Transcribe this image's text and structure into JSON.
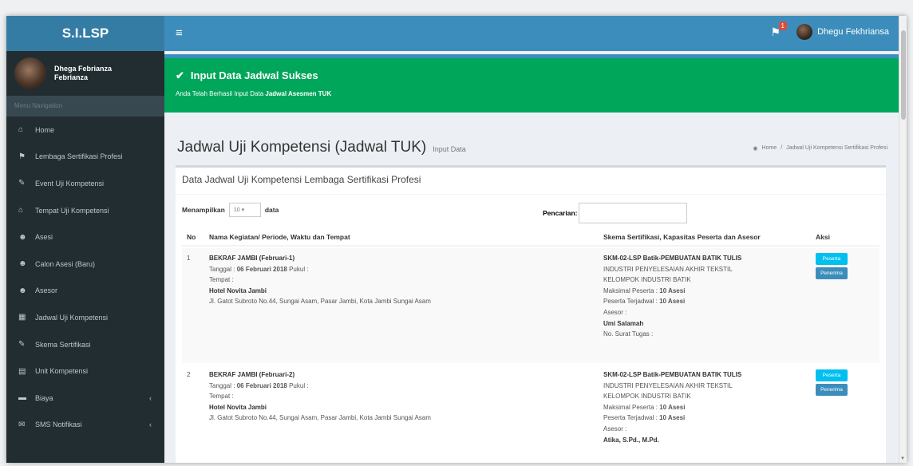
{
  "header": {
    "logo": "S.I.LSP",
    "menu_icon": "bars-icon",
    "notification_icon": "flag-icon",
    "notification_count": "1",
    "user_name": "Dhegu Fekhriansa"
  },
  "sidebar": {
    "user_name": "Dhega Febrianza Febrianza",
    "search_placeholder": "Menu Navigation",
    "items": [
      {
        "label": "Home",
        "icon": "home-icon",
        "has_caret": false
      },
      {
        "label": "Lembaga Sertifikasi Profesi",
        "icon": "flag-icon",
        "has_caret": false
      },
      {
        "label": "Event Uji Kompetensi",
        "icon": "edit-icon",
        "has_caret": false
      },
      {
        "label": "Tempat Uji Kompetensi",
        "icon": "institution-icon",
        "has_caret": false
      },
      {
        "label": "Asesi",
        "icon": "users-icon",
        "has_caret": false
      },
      {
        "label": "Calon Asesi (Baru)",
        "icon": "users-icon",
        "has_caret": false
      },
      {
        "label": "Asesor",
        "icon": "users-icon",
        "has_caret": false
      },
      {
        "label": "Jadwal Uji Kompetensi",
        "icon": "calendar-icon",
        "has_caret": false
      },
      {
        "label": "Skema Sertifikasi",
        "icon": "edit-icon",
        "has_caret": false
      },
      {
        "label": "Unit Kompetensi",
        "icon": "file-icon",
        "has_caret": false
      },
      {
        "label": "Biaya",
        "icon": "folder-icon",
        "has_caret": true
      },
      {
        "label": "SMS Notifikasi",
        "icon": "envelope-icon",
        "has_caret": true
      }
    ]
  },
  "alert": {
    "title": "Input Data Jadwal Sukses",
    "message_prefix": "Anda Telah Berhasil Input Data ",
    "message_bold": "Jadwal Asesmen TUK"
  },
  "page": {
    "title": "Jadwal Uji Kompetensi (Jadwal TUK)",
    "subtitle": "Input Data",
    "breadcrumb_home": "Home",
    "breadcrumb_current": "Jadwal Uji Kompetensi Sertifikasi Profesi"
  },
  "box": {
    "title": "Data Jadwal Uji Kompetensi Lembaga Sertifikasi Profesi",
    "show_label": "Menampilkan",
    "show_value": "10",
    "show_suffix": "data",
    "search_label": "Pencarian:"
  },
  "table": {
    "headers": {
      "no": "No",
      "kegiatan": "Nama Kegiatan/ Periode, Waktu dan Tempat",
      "skema": "Skema Sertifikasi, Kapasitas Peserta dan Asesor",
      "aksi": "Aksi"
    },
    "rows": [
      {
        "no": "1",
        "kegiatan": "BEKRAF JAMBI (Februari-1)",
        "tanggal_label": "Tanggal : ",
        "tanggal": "06 Februari 2018",
        "pukul": " Pukul :",
        "tempat_label": "Tempat :",
        "tempat": "Hotel Novita Jambi",
        "alamat": "Jl. Gatot Subroto No.44, Sungai Asam, Pasar Jambi, Kota Jambi Sungai Asam",
        "skema": "SKM-02-LSP Batik-PEMBUATAN BATIK TULIS",
        "skema_desc1": "INDUSTRI PENYELESAIAN AKHIR TEKSTIL",
        "skema_desc2": "KELOMPOK INDUSTRI BATIK",
        "maks_label": "Maksimal Peserta : ",
        "maks": "10 Asesi",
        "terjadwal_label": "Peserta Terjadwal : ",
        "terjadwal": "10 Asesi",
        "asesor_label": "Asesor :",
        "asesor": "Umi Salamah",
        "surat": "No. Surat Tugas :",
        "btn1": "Peserta",
        "btn2": "Penerima"
      },
      {
        "no": "2",
        "kegiatan": "BEKRAF JAMBI (Februari-2)",
        "tanggal_label": "Tanggal : ",
        "tanggal": "06 Februari 2018",
        "pukul": " Pukul :",
        "tempat_label": "Tempat :",
        "tempat": "Hotel Novita Jambi",
        "alamat": "Jl. Gatot Subroto No.44, Sungai Asam, Pasar Jambi, Kota Jambi Sungai Asam",
        "skema": "SKM-02-LSP Batik-PEMBUATAN BATIK TULIS",
        "skema_desc1": "INDUSTRI PENYELESAIAN AKHIR TEKSTIL",
        "skema_desc2": "KELOMPOK INDUSTRI BATIK",
        "maks_label": "Maksimal Peserta : ",
        "maks": "10 Asesi",
        "terjadwal_label": "Peserta Terjadwal : ",
        "terjadwal": "10 Asesi",
        "asesor_label": "Asesor :",
        "asesor": "Atika, S.Pd., M.Pd.",
        "surat": "",
        "btn1": "Peserta",
        "btn2": "Penerima"
      }
    ]
  }
}
